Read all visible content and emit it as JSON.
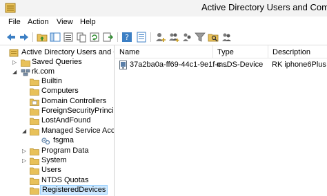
{
  "window": {
    "title": "Active Directory Users and Comput"
  },
  "menu": [
    "File",
    "Action",
    "View",
    "Help"
  ],
  "tree": {
    "root_label": "Active Directory Users and Com",
    "items": [
      {
        "label": "Saved Queries"
      },
      {
        "label": "rk.com"
      },
      {
        "label": "Builtin"
      },
      {
        "label": "Computers"
      },
      {
        "label": "Domain Controllers"
      },
      {
        "label": "ForeignSecurityPrincipals"
      },
      {
        "label": "LostAndFound"
      },
      {
        "label": "Managed Service Accour"
      },
      {
        "label": "fsgma"
      },
      {
        "label": "Program Data"
      },
      {
        "label": "System"
      },
      {
        "label": "Users"
      },
      {
        "label": "NTDS Quotas"
      },
      {
        "label": "RegisteredDevices"
      }
    ]
  },
  "list": {
    "columns": [
      "Name",
      "Type",
      "Description"
    ],
    "rows": [
      {
        "name": "37a2ba0a-ff69-44c1-9e1f-c...",
        "type": "msDS-Device",
        "description": "RK iphone6Plus"
      }
    ]
  },
  "colors": {
    "selection": "#cce8ff",
    "folder": "#e8c15a",
    "accent": "#3c7fc4"
  }
}
